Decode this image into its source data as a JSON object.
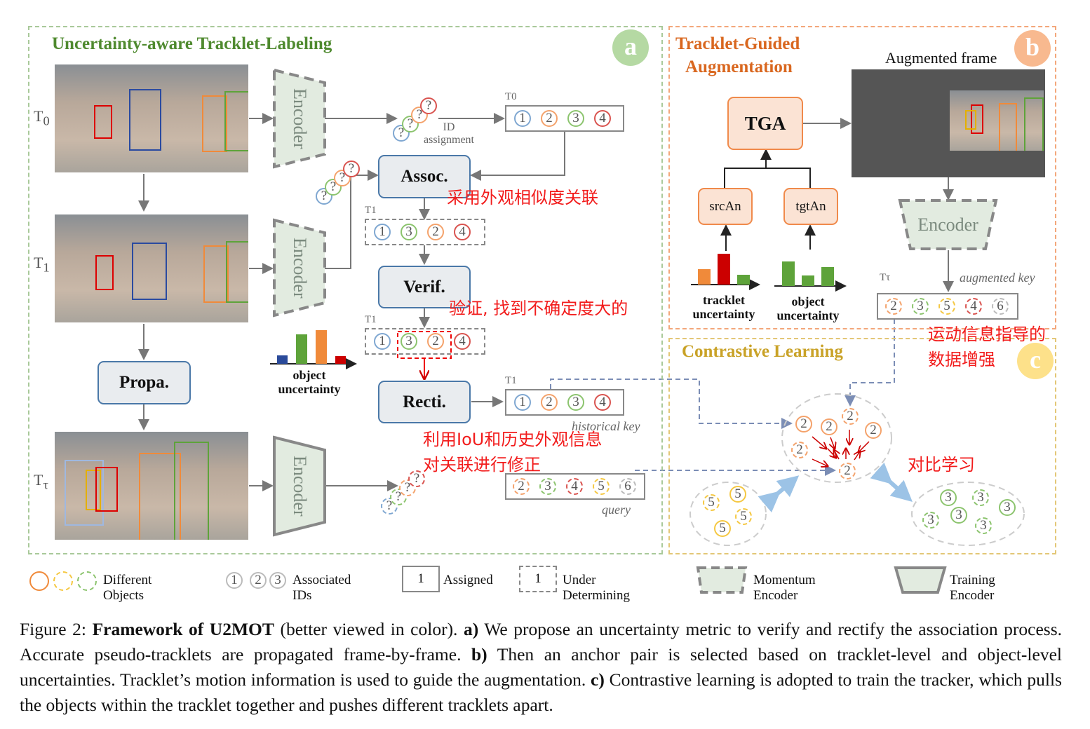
{
  "panel_a": {
    "title": "Uncertainty-aware Tracklet-Labeling",
    "badge": "a",
    "frames": [
      "T",
      "T",
      "T"
    ],
    "frame_subs": [
      "0",
      "1",
      "τ"
    ],
    "encoder_label": "Encoder",
    "id_assignment": "ID\nassignment",
    "assoc": "Assoc.",
    "verif": "Verif.",
    "recti": "Recti.",
    "propa": "Propa.",
    "row_labels": {
      "t0": "T0",
      "t1_assoc": "T1",
      "t1_verif": "T1",
      "t1_recti": "T1"
    },
    "rows": {
      "t0": [
        1,
        2,
        3,
        4
      ],
      "assoc": [
        1,
        3,
        2,
        4
      ],
      "verif": [
        1,
        3,
        2,
        4
      ],
      "recti": [
        1,
        2,
        3,
        4
      ],
      "query": [
        2,
        3,
        4,
        5,
        6
      ]
    },
    "historical_key": "historical key",
    "query_label": "query",
    "object_uncertainty": "object\nuncertainty",
    "question_mark": "?"
  },
  "panel_b": {
    "title_line1": "Tracklet-Guided",
    "title_line2": "Augmentation",
    "badge": "b",
    "augmented_frame": "Augmented frame",
    "tga": "TGA",
    "srcan": "srcAn",
    "tgtan": "tgtAn",
    "tracklet_uncertainty": "tracklet\nuncertainty",
    "object_uncertainty": "object\nuncertainty",
    "encoder_label": "Encoder",
    "augmented_key": "augmented key",
    "row_label": "Tτ",
    "row": [
      2,
      3,
      5,
      4,
      6
    ]
  },
  "panel_c": {
    "title": "Contrastive Learning",
    "badge": "c"
  },
  "annotations_cn": {
    "assoc": "采用外观相似度关联",
    "verif": "验证, 找到不确定度大的",
    "recti_1": "利用IoU和历史外观信息",
    "recti_2": "对关联进行修正",
    "tga_1": "运动信息指导的",
    "tga_2": "数据增强",
    "contrast": "对比学习"
  },
  "legend": {
    "different_objects": "Different Objects",
    "associated_ids": "Associated IDs",
    "id_nums": [
      "1",
      "2",
      "3"
    ],
    "assigned": "Assigned",
    "under_determining": "Under Determining",
    "momentum_encoder": "Momentum Encoder",
    "training_encoder": "Training Encoder",
    "sample_id": "1"
  },
  "caption": {
    "prefix": "Figure 2: ",
    "bold1": "Framework of U2MOT",
    "t1": " (better viewed in color). ",
    "bold2": "a)",
    "t2": " We propose an uncertainty metric to verify and rectify the association process. Accurate pseudo-tracklets are propagated frame-by-frame. ",
    "bold3": "b)",
    "t3": " Then an anchor pair is selected based on tracklet-level and object-level uncertainties. Tracklet’s motion information is used to guide the augmentation. ",
    "bold4": "c)",
    "t4": " Contrastive learning is adopted to train the tracker, which pulls the objects within the tracklet together and pushes different tracklets apart."
  },
  "colors": {
    "id1": "#7fa7d1",
    "id2": "#f4a26b",
    "id3": "#8cc46e",
    "id4": "#d9534f",
    "id5": "#f5c842",
    "id6": "#bbbbbb",
    "panel_a": "#a9c99a",
    "panel_b": "#f3a77b",
    "panel_c": "#e3c777",
    "title_green": "#4f8a2f",
    "title_orange": "#d9671f",
    "title_gold": "#c9a227",
    "annotation": "#f21c1c"
  }
}
